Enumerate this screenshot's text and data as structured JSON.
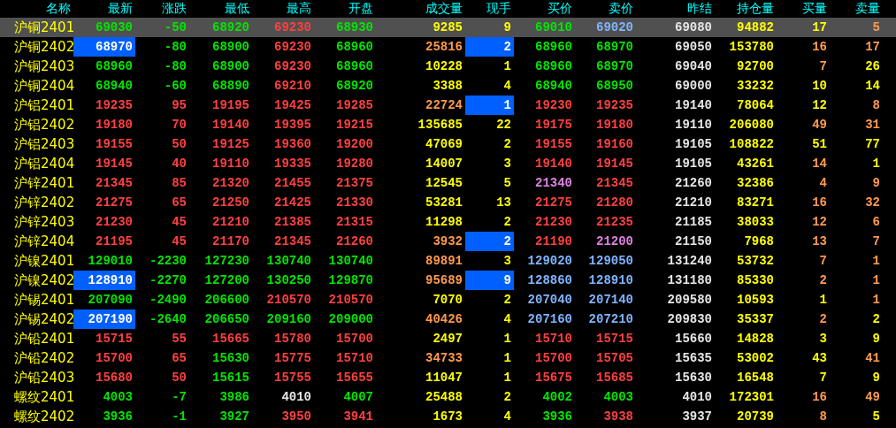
{
  "columns": [
    "名称",
    "最新",
    "涨跌",
    "最低",
    "最高",
    "开盘",
    "成交量",
    "现手",
    "买价",
    "卖价",
    "昨结",
    "持仓量",
    "买量",
    "卖量"
  ],
  "rows": [
    {
      "name": "沪铜2401",
      "selected": true,
      "cells": [
        {
          "text": "69030",
          "color": "#00e600",
          "highlighted": false
        },
        {
          "text": "-50",
          "color": "#00e600",
          "highlighted": false
        },
        {
          "text": "68920",
          "color": "#00e600",
          "highlighted": false
        },
        {
          "text": "69230",
          "color": "#ff4040",
          "highlighted": false
        },
        {
          "text": "68930",
          "color": "#00e600",
          "highlighted": false
        },
        {
          "text": "9285",
          "color": "#ffff00",
          "highlighted": false
        },
        {
          "text": "9",
          "color": "#ffff00",
          "highlighted": false
        },
        {
          "text": "69010",
          "color": "#00e600",
          "highlighted": false
        },
        {
          "text": "69020",
          "color": "#80b4ff",
          "highlighted": false
        },
        {
          "text": "69080",
          "color": "#e6e6e6",
          "highlighted": false
        },
        {
          "text": "94882",
          "color": "#ffff00",
          "highlighted": false
        },
        {
          "text": "17",
          "color": "#ffff00",
          "highlighted": false
        },
        {
          "text": "5",
          "color": "#ff9a50",
          "highlighted": false
        }
      ]
    },
    {
      "name": "沪铜2402",
      "selected": false,
      "cells": [
        {
          "text": "68970",
          "color": "#ffffff",
          "highlighted": true
        },
        {
          "text": "-80",
          "color": "#00e600",
          "highlighted": false
        },
        {
          "text": "68900",
          "color": "#00e600",
          "highlighted": false
        },
        {
          "text": "69230",
          "color": "#ff4040",
          "highlighted": false
        },
        {
          "text": "68960",
          "color": "#00e600",
          "highlighted": false
        },
        {
          "text": "25816",
          "color": "#ff9a50",
          "highlighted": false
        },
        {
          "text": "2",
          "color": "#ffffff",
          "highlighted": true
        },
        {
          "text": "68960",
          "color": "#00e600",
          "highlighted": false
        },
        {
          "text": "68970",
          "color": "#00e600",
          "highlighted": false
        },
        {
          "text": "69050",
          "color": "#e6e6e6",
          "highlighted": false
        },
        {
          "text": "153780",
          "color": "#ffff00",
          "highlighted": false
        },
        {
          "text": "16",
          "color": "#ff9a50",
          "highlighted": false
        },
        {
          "text": "17",
          "color": "#ff9a50",
          "highlighted": false
        }
      ]
    },
    {
      "name": "沪铜2403",
      "selected": false,
      "cells": [
        {
          "text": "68960",
          "color": "#00e600",
          "highlighted": false
        },
        {
          "text": "-80",
          "color": "#00e600",
          "highlighted": false
        },
        {
          "text": "68900",
          "color": "#00e600",
          "highlighted": false
        },
        {
          "text": "69230",
          "color": "#ff4040",
          "highlighted": false
        },
        {
          "text": "68960",
          "color": "#00e600",
          "highlighted": false
        },
        {
          "text": "10228",
          "color": "#ffff00",
          "highlighted": false
        },
        {
          "text": "1",
          "color": "#ffff00",
          "highlighted": false
        },
        {
          "text": "68960",
          "color": "#00e600",
          "highlighted": false
        },
        {
          "text": "68970",
          "color": "#00e600",
          "highlighted": false
        },
        {
          "text": "69040",
          "color": "#e6e6e6",
          "highlighted": false
        },
        {
          "text": "92700",
          "color": "#ffff00",
          "highlighted": false
        },
        {
          "text": "7",
          "color": "#ff9a50",
          "highlighted": false
        },
        {
          "text": "26",
          "color": "#ffff00",
          "highlighted": false
        }
      ]
    },
    {
      "name": "沪铜2404",
      "selected": false,
      "cells": [
        {
          "text": "68940",
          "color": "#00e600",
          "highlighted": false
        },
        {
          "text": "-60",
          "color": "#00e600",
          "highlighted": false
        },
        {
          "text": "68890",
          "color": "#00e600",
          "highlighted": false
        },
        {
          "text": "69210",
          "color": "#ff4040",
          "highlighted": false
        },
        {
          "text": "68920",
          "color": "#00e600",
          "highlighted": false
        },
        {
          "text": "3388",
          "color": "#ffff00",
          "highlighted": false
        },
        {
          "text": "4",
          "color": "#ffff00",
          "highlighted": false
        },
        {
          "text": "68940",
          "color": "#00e600",
          "highlighted": false
        },
        {
          "text": "68950",
          "color": "#00e600",
          "highlighted": false
        },
        {
          "text": "69000",
          "color": "#e6e6e6",
          "highlighted": false
        },
        {
          "text": "33232",
          "color": "#ffff00",
          "highlighted": false
        },
        {
          "text": "10",
          "color": "#ffff00",
          "highlighted": false
        },
        {
          "text": "14",
          "color": "#ffff00",
          "highlighted": false
        }
      ]
    },
    {
      "name": "沪铝2401",
      "selected": false,
      "cells": [
        {
          "text": "19235",
          "color": "#ff4040",
          "highlighted": false
        },
        {
          "text": "95",
          "color": "#ff4040",
          "highlighted": false
        },
        {
          "text": "19195",
          "color": "#ff4040",
          "highlighted": false
        },
        {
          "text": "19425",
          "color": "#ff4040",
          "highlighted": false
        },
        {
          "text": "19285",
          "color": "#ff4040",
          "highlighted": false
        },
        {
          "text": "22724",
          "color": "#ff9a50",
          "highlighted": false
        },
        {
          "text": "1",
          "color": "#ffffff",
          "highlighted": true
        },
        {
          "text": "19230",
          "color": "#ff4040",
          "highlighted": false
        },
        {
          "text": "19235",
          "color": "#ff4040",
          "highlighted": false
        },
        {
          "text": "19140",
          "color": "#e6e6e6",
          "highlighted": false
        },
        {
          "text": "78064",
          "color": "#ffff00",
          "highlighted": false
        },
        {
          "text": "12",
          "color": "#ffff00",
          "highlighted": false
        },
        {
          "text": "8",
          "color": "#ff9a50",
          "highlighted": false
        }
      ]
    },
    {
      "name": "沪铝2402",
      "selected": false,
      "cells": [
        {
          "text": "19180",
          "color": "#ff4040",
          "highlighted": false
        },
        {
          "text": "70",
          "color": "#ff4040",
          "highlighted": false
        },
        {
          "text": "19140",
          "color": "#ff4040",
          "highlighted": false
        },
        {
          "text": "19395",
          "color": "#ff4040",
          "highlighted": false
        },
        {
          "text": "19215",
          "color": "#ff4040",
          "highlighted": false
        },
        {
          "text": "135685",
          "color": "#ffff00",
          "highlighted": false
        },
        {
          "text": "22",
          "color": "#ffff00",
          "highlighted": false
        },
        {
          "text": "19175",
          "color": "#ff4040",
          "highlighted": false
        },
        {
          "text": "19180",
          "color": "#ff4040",
          "highlighted": false
        },
        {
          "text": "19110",
          "color": "#e6e6e6",
          "highlighted": false
        },
        {
          "text": "206080",
          "color": "#ffff00",
          "highlighted": false
        },
        {
          "text": "49",
          "color": "#ff9a50",
          "highlighted": false
        },
        {
          "text": "31",
          "color": "#ff9a50",
          "highlighted": false
        }
      ]
    },
    {
      "name": "沪铝2403",
      "selected": false,
      "cells": [
        {
          "text": "19155",
          "color": "#ff4040",
          "highlighted": false
        },
        {
          "text": "50",
          "color": "#ff4040",
          "highlighted": false
        },
        {
          "text": "19125",
          "color": "#ff4040",
          "highlighted": false
        },
        {
          "text": "19360",
          "color": "#ff4040",
          "highlighted": false
        },
        {
          "text": "19200",
          "color": "#ff4040",
          "highlighted": false
        },
        {
          "text": "47069",
          "color": "#ffff00",
          "highlighted": false
        },
        {
          "text": "2",
          "color": "#ffff00",
          "highlighted": false
        },
        {
          "text": "19155",
          "color": "#ff4040",
          "highlighted": false
        },
        {
          "text": "19160",
          "color": "#ff4040",
          "highlighted": false
        },
        {
          "text": "19105",
          "color": "#e6e6e6",
          "highlighted": false
        },
        {
          "text": "108822",
          "color": "#ffff00",
          "highlighted": false
        },
        {
          "text": "51",
          "color": "#ffff00",
          "highlighted": false
        },
        {
          "text": "77",
          "color": "#ffff00",
          "highlighted": false
        }
      ]
    },
    {
      "name": "沪铝2404",
      "selected": false,
      "cells": [
        {
          "text": "19145",
          "color": "#ff4040",
          "highlighted": false
        },
        {
          "text": "40",
          "color": "#ff4040",
          "highlighted": false
        },
        {
          "text": "19110",
          "color": "#ff4040",
          "highlighted": false
        },
        {
          "text": "19335",
          "color": "#ff4040",
          "highlighted": false
        },
        {
          "text": "19280",
          "color": "#ff4040",
          "highlighted": false
        },
        {
          "text": "14007",
          "color": "#ffff00",
          "highlighted": false
        },
        {
          "text": "3",
          "color": "#ffff00",
          "highlighted": false
        },
        {
          "text": "19140",
          "color": "#ff4040",
          "highlighted": false
        },
        {
          "text": "19145",
          "color": "#ff4040",
          "highlighted": false
        },
        {
          "text": "19105",
          "color": "#e6e6e6",
          "highlighted": false
        },
        {
          "text": "43261",
          "color": "#ffff00",
          "highlighted": false
        },
        {
          "text": "14",
          "color": "#ff9a50",
          "highlighted": false
        },
        {
          "text": "1",
          "color": "#ffff00",
          "highlighted": false
        }
      ]
    },
    {
      "name": "沪锌2401",
      "selected": false,
      "cells": [
        {
          "text": "21345",
          "color": "#ff4040",
          "highlighted": false
        },
        {
          "text": "85",
          "color": "#ff4040",
          "highlighted": false
        },
        {
          "text": "21320",
          "color": "#ff4040",
          "highlighted": false
        },
        {
          "text": "21455",
          "color": "#ff4040",
          "highlighted": false
        },
        {
          "text": "21375",
          "color": "#ff4040",
          "highlighted": false
        },
        {
          "text": "12545",
          "color": "#ffff00",
          "highlighted": false
        },
        {
          "text": "5",
          "color": "#ffff00",
          "highlighted": false
        },
        {
          "text": "21340",
          "color": "#e080e0",
          "highlighted": false
        },
        {
          "text": "21345",
          "color": "#ff4040",
          "highlighted": false
        },
        {
          "text": "21260",
          "color": "#e6e6e6",
          "highlighted": false
        },
        {
          "text": "32386",
          "color": "#ffff00",
          "highlighted": false
        },
        {
          "text": "4",
          "color": "#ff9a50",
          "highlighted": false
        },
        {
          "text": "9",
          "color": "#ff9a50",
          "highlighted": false
        }
      ]
    },
    {
      "name": "沪锌2402",
      "selected": false,
      "cells": [
        {
          "text": "21275",
          "color": "#ff4040",
          "highlighted": false
        },
        {
          "text": "65",
          "color": "#ff4040",
          "highlighted": false
        },
        {
          "text": "21250",
          "color": "#ff4040",
          "highlighted": false
        },
        {
          "text": "21425",
          "color": "#ff4040",
          "highlighted": false
        },
        {
          "text": "21330",
          "color": "#ff4040",
          "highlighted": false
        },
        {
          "text": "53281",
          "color": "#ffff00",
          "highlighted": false
        },
        {
          "text": "13",
          "color": "#ffff00",
          "highlighted": false
        },
        {
          "text": "21275",
          "color": "#ff4040",
          "highlighted": false
        },
        {
          "text": "21280",
          "color": "#ff4040",
          "highlighted": false
        },
        {
          "text": "21210",
          "color": "#e6e6e6",
          "highlighted": false
        },
        {
          "text": "83271",
          "color": "#ffff00",
          "highlighted": false
        },
        {
          "text": "16",
          "color": "#ff9a50",
          "highlighted": false
        },
        {
          "text": "32",
          "color": "#ff9a50",
          "highlighted": false
        }
      ]
    },
    {
      "name": "沪锌2403",
      "selected": false,
      "cells": [
        {
          "text": "21230",
          "color": "#ff4040",
          "highlighted": false
        },
        {
          "text": "45",
          "color": "#ff4040",
          "highlighted": false
        },
        {
          "text": "21210",
          "color": "#ff4040",
          "highlighted": false
        },
        {
          "text": "21385",
          "color": "#ff4040",
          "highlighted": false
        },
        {
          "text": "21315",
          "color": "#ff4040",
          "highlighted": false
        },
        {
          "text": "11298",
          "color": "#ffff00",
          "highlighted": false
        },
        {
          "text": "2",
          "color": "#ffff00",
          "highlighted": false
        },
        {
          "text": "21230",
          "color": "#ff4040",
          "highlighted": false
        },
        {
          "text": "21235",
          "color": "#ff4040",
          "highlighted": false
        },
        {
          "text": "21185",
          "color": "#e6e6e6",
          "highlighted": false
        },
        {
          "text": "38033",
          "color": "#ffff00",
          "highlighted": false
        },
        {
          "text": "12",
          "color": "#ff9a50",
          "highlighted": false
        },
        {
          "text": "6",
          "color": "#ff9a50",
          "highlighted": false
        }
      ]
    },
    {
      "name": "沪锌2404",
      "selected": false,
      "cells": [
        {
          "text": "21195",
          "color": "#ff4040",
          "highlighted": false
        },
        {
          "text": "45",
          "color": "#ff4040",
          "highlighted": false
        },
        {
          "text": "21170",
          "color": "#ff4040",
          "highlighted": false
        },
        {
          "text": "21345",
          "color": "#ff4040",
          "highlighted": false
        },
        {
          "text": "21260",
          "color": "#ff4040",
          "highlighted": false
        },
        {
          "text": "3932",
          "color": "#ff9a50",
          "highlighted": false
        },
        {
          "text": "2",
          "color": "#ffffff",
          "highlighted": true
        },
        {
          "text": "21190",
          "color": "#ff4040",
          "highlighted": false
        },
        {
          "text": "21200",
          "color": "#e080e0",
          "highlighted": false
        },
        {
          "text": "21150",
          "color": "#e6e6e6",
          "highlighted": false
        },
        {
          "text": "7968",
          "color": "#ffff00",
          "highlighted": false
        },
        {
          "text": "13",
          "color": "#ff9a50",
          "highlighted": false
        },
        {
          "text": "7",
          "color": "#ff9a50",
          "highlighted": false
        }
      ]
    },
    {
      "name": "沪镍2401",
      "selected": false,
      "cells": [
        {
          "text": "129010",
          "color": "#00e600",
          "highlighted": false
        },
        {
          "text": "-2230",
          "color": "#00e600",
          "highlighted": false
        },
        {
          "text": "127230",
          "color": "#00e600",
          "highlighted": false
        },
        {
          "text": "130740",
          "color": "#00e600",
          "highlighted": false
        },
        {
          "text": "130740",
          "color": "#00e600",
          "highlighted": false
        },
        {
          "text": "89891",
          "color": "#ff9a50",
          "highlighted": false
        },
        {
          "text": "3",
          "color": "#ffff00",
          "highlighted": false
        },
        {
          "text": "129020",
          "color": "#80b4ff",
          "highlighted": false
        },
        {
          "text": "129050",
          "color": "#80b4ff",
          "highlighted": false
        },
        {
          "text": "131240",
          "color": "#e6e6e6",
          "highlighted": false
        },
        {
          "text": "53732",
          "color": "#ffff00",
          "highlighted": false
        },
        {
          "text": "7",
          "color": "#ff9a50",
          "highlighted": false
        },
        {
          "text": "1",
          "color": "#ff9a50",
          "highlighted": false
        }
      ]
    },
    {
      "name": "沪镍2402",
      "selected": false,
      "cells": [
        {
          "text": "128910",
          "color": "#ffffff",
          "highlighted": true
        },
        {
          "text": "-2270",
          "color": "#00e600",
          "highlighted": false
        },
        {
          "text": "127200",
          "color": "#00e600",
          "highlighted": false
        },
        {
          "text": "130250",
          "color": "#00e600",
          "highlighted": false
        },
        {
          "text": "129870",
          "color": "#00e600",
          "highlighted": false
        },
        {
          "text": "95689",
          "color": "#ff9a50",
          "highlighted": false
        },
        {
          "text": "9",
          "color": "#ffffff",
          "highlighted": true
        },
        {
          "text": "128860",
          "color": "#80b4ff",
          "highlighted": false
        },
        {
          "text": "128910",
          "color": "#80b4ff",
          "highlighted": false
        },
        {
          "text": "131180",
          "color": "#e6e6e6",
          "highlighted": false
        },
        {
          "text": "85330",
          "color": "#ffff00",
          "highlighted": false
        },
        {
          "text": "2",
          "color": "#ff9a50",
          "highlighted": false
        },
        {
          "text": "1",
          "color": "#ff9a50",
          "highlighted": false
        }
      ]
    },
    {
      "name": "沪锡2401",
      "selected": false,
      "cells": [
        {
          "text": "207090",
          "color": "#00e600",
          "highlighted": false
        },
        {
          "text": "-2490",
          "color": "#00e600",
          "highlighted": false
        },
        {
          "text": "206600",
          "color": "#00e600",
          "highlighted": false
        },
        {
          "text": "210570",
          "color": "#ff4040",
          "highlighted": false
        },
        {
          "text": "210570",
          "color": "#ff4040",
          "highlighted": false
        },
        {
          "text": "7070",
          "color": "#ffff00",
          "highlighted": false
        },
        {
          "text": "2",
          "color": "#ffff00",
          "highlighted": false
        },
        {
          "text": "207040",
          "color": "#80b4ff",
          "highlighted": false
        },
        {
          "text": "207140",
          "color": "#80b4ff",
          "highlighted": false
        },
        {
          "text": "209580",
          "color": "#e6e6e6",
          "highlighted": false
        },
        {
          "text": "10593",
          "color": "#ffff00",
          "highlighted": false
        },
        {
          "text": "1",
          "color": "#ffff00",
          "highlighted": false
        },
        {
          "text": "1",
          "color": "#ff9a50",
          "highlighted": false
        }
      ]
    },
    {
      "name": "沪锡2402",
      "selected": false,
      "cells": [
        {
          "text": "207190",
          "color": "#ffffff",
          "highlighted": true
        },
        {
          "text": "-2640",
          "color": "#00e600",
          "highlighted": false
        },
        {
          "text": "206650",
          "color": "#00e600",
          "highlighted": false
        },
        {
          "text": "209160",
          "color": "#00e600",
          "highlighted": false
        },
        {
          "text": "209000",
          "color": "#00e600",
          "highlighted": false
        },
        {
          "text": "40426",
          "color": "#ff9a50",
          "highlighted": false
        },
        {
          "text": "4",
          "color": "#ffff00",
          "highlighted": false
        },
        {
          "text": "207160",
          "color": "#80b4ff",
          "highlighted": false
        },
        {
          "text": "207210",
          "color": "#80b4ff",
          "highlighted": false
        },
        {
          "text": "209830",
          "color": "#e6e6e6",
          "highlighted": false
        },
        {
          "text": "35337",
          "color": "#ffff00",
          "highlighted": false
        },
        {
          "text": "2",
          "color": "#ff9a50",
          "highlighted": false
        },
        {
          "text": "2",
          "color": "#ffff00",
          "highlighted": false
        }
      ]
    },
    {
      "name": "沪铅2401",
      "selected": false,
      "cells": [
        {
          "text": "15715",
          "color": "#ff4040",
          "highlighted": false
        },
        {
          "text": "55",
          "color": "#ff4040",
          "highlighted": false
        },
        {
          "text": "15665",
          "color": "#ff4040",
          "highlighted": false
        },
        {
          "text": "15780",
          "color": "#ff4040",
          "highlighted": false
        },
        {
          "text": "15700",
          "color": "#ff4040",
          "highlighted": false
        },
        {
          "text": "2497",
          "color": "#ffff00",
          "highlighted": false
        },
        {
          "text": "1",
          "color": "#ffff00",
          "highlighted": false
        },
        {
          "text": "15710",
          "color": "#ff4040",
          "highlighted": false
        },
        {
          "text": "15715",
          "color": "#ff4040",
          "highlighted": false
        },
        {
          "text": "15660",
          "color": "#e6e6e6",
          "highlighted": false
        },
        {
          "text": "14828",
          "color": "#ffff00",
          "highlighted": false
        },
        {
          "text": "3",
          "color": "#ffff00",
          "highlighted": false
        },
        {
          "text": "9",
          "color": "#ffff00",
          "highlighted": false
        }
      ]
    },
    {
      "name": "沪铅2402",
      "selected": false,
      "cells": [
        {
          "text": "15700",
          "color": "#ff4040",
          "highlighted": false
        },
        {
          "text": "65",
          "color": "#ff4040",
          "highlighted": false
        },
        {
          "text": "15630",
          "color": "#00e600",
          "highlighted": false
        },
        {
          "text": "15775",
          "color": "#ff4040",
          "highlighted": false
        },
        {
          "text": "15710",
          "color": "#ff4040",
          "highlighted": false
        },
        {
          "text": "34733",
          "color": "#ff9a50",
          "highlighted": false
        },
        {
          "text": "1",
          "color": "#ffff00",
          "highlighted": false
        },
        {
          "text": "15700",
          "color": "#ff4040",
          "highlighted": false
        },
        {
          "text": "15705",
          "color": "#ff4040",
          "highlighted": false
        },
        {
          "text": "15635",
          "color": "#e6e6e6",
          "highlighted": false
        },
        {
          "text": "53002",
          "color": "#ffff00",
          "highlighted": false
        },
        {
          "text": "43",
          "color": "#ffff00",
          "highlighted": false
        },
        {
          "text": "41",
          "color": "#ff9a50",
          "highlighted": false
        }
      ]
    },
    {
      "name": "沪铅2403",
      "selected": false,
      "cells": [
        {
          "text": "15680",
          "color": "#ff4040",
          "highlighted": false
        },
        {
          "text": "50",
          "color": "#ff4040",
          "highlighted": false
        },
        {
          "text": "15615",
          "color": "#00e600",
          "highlighted": false
        },
        {
          "text": "15755",
          "color": "#ff4040",
          "highlighted": false
        },
        {
          "text": "15655",
          "color": "#ff4040",
          "highlighted": false
        },
        {
          "text": "11047",
          "color": "#ffff00",
          "highlighted": false
        },
        {
          "text": "1",
          "color": "#ffff00",
          "highlighted": false
        },
        {
          "text": "15675",
          "color": "#ff4040",
          "highlighted": false
        },
        {
          "text": "15685",
          "color": "#ff4040",
          "highlighted": false
        },
        {
          "text": "15630",
          "color": "#e6e6e6",
          "highlighted": false
        },
        {
          "text": "16548",
          "color": "#ffff00",
          "highlighted": false
        },
        {
          "text": "7",
          "color": "#ffff00",
          "highlighted": false
        },
        {
          "text": "9",
          "color": "#ffff00",
          "highlighted": false
        }
      ]
    },
    {
      "name": "螺纹2401",
      "selected": false,
      "cells": [
        {
          "text": "4003",
          "color": "#00e600",
          "highlighted": false
        },
        {
          "text": "-7",
          "color": "#00e600",
          "highlighted": false
        },
        {
          "text": "3986",
          "color": "#00e600",
          "highlighted": false
        },
        {
          "text": "4010",
          "color": "#e6e6e6",
          "highlighted": false
        },
        {
          "text": "4007",
          "color": "#00e600",
          "highlighted": false
        },
        {
          "text": "25488",
          "color": "#ffff00",
          "highlighted": false
        },
        {
          "text": "2",
          "color": "#ffff00",
          "highlighted": false
        },
        {
          "text": "4002",
          "color": "#00e600",
          "highlighted": false
        },
        {
          "text": "4003",
          "color": "#00e600",
          "highlighted": false
        },
        {
          "text": "4010",
          "color": "#e6e6e6",
          "highlighted": false
        },
        {
          "text": "172301",
          "color": "#ffff00",
          "highlighted": false
        },
        {
          "text": "16",
          "color": "#ff9a50",
          "highlighted": false
        },
        {
          "text": "49",
          "color": "#ff9a50",
          "highlighted": false
        }
      ]
    },
    {
      "name": "螺纹2402",
      "selected": false,
      "cells": [
        {
          "text": "3936",
          "color": "#00e600",
          "highlighted": false
        },
        {
          "text": "-1",
          "color": "#00e600",
          "highlighted": false
        },
        {
          "text": "3927",
          "color": "#00e600",
          "highlighted": false
        },
        {
          "text": "3950",
          "color": "#ff4040",
          "highlighted": false
        },
        {
          "text": "3941",
          "color": "#ff4040",
          "highlighted": false
        },
        {
          "text": "1673",
          "color": "#ffff00",
          "highlighted": false
        },
        {
          "text": "4",
          "color": "#ffff00",
          "highlighted": false
        },
        {
          "text": "3936",
          "color": "#00e600",
          "highlighted": false
        },
        {
          "text": "3938",
          "color": "#ff4040",
          "highlighted": false
        },
        {
          "text": "3937",
          "color": "#e6e6e6",
          "highlighted": false
        },
        {
          "text": "20739",
          "color": "#ffff00",
          "highlighted": false
        },
        {
          "text": "8",
          "color": "#ff9a50",
          "highlighted": false
        },
        {
          "text": "5",
          "color": "#ffff00",
          "highlighted": false
        }
      ]
    }
  ]
}
